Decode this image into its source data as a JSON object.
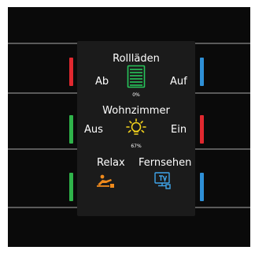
{
  "panel": {
    "rollladen": {
      "title": "Rollläden",
      "left": "Ab",
      "right": "Auf",
      "percent": "0%"
    },
    "wohnzimmer": {
      "title": "Wohnzimmer",
      "left": "Aus",
      "right": "Ein",
      "percent": "67%"
    },
    "scenes": {
      "left": "Relax",
      "right": "Fernsehen"
    }
  },
  "leds": {
    "row1": {
      "left": "#e0282f",
      "right": "#2e8fd6"
    },
    "row2": {
      "left": "#2fb34a",
      "right": "#e0282f"
    },
    "row3": {
      "left": "#2fb34a",
      "right": "#2e8fd6"
    }
  },
  "icons": {
    "rollladen": "shutter-icon",
    "wohnzimmer": "lightbulb-icon",
    "relax": "recliner-icon",
    "fernsehen": "tv-icon"
  },
  "colors": {
    "shutter": "#27c45a",
    "bulb": "#f2d21c",
    "relax": "#f08a1c",
    "tv": "#3fa5ea"
  }
}
